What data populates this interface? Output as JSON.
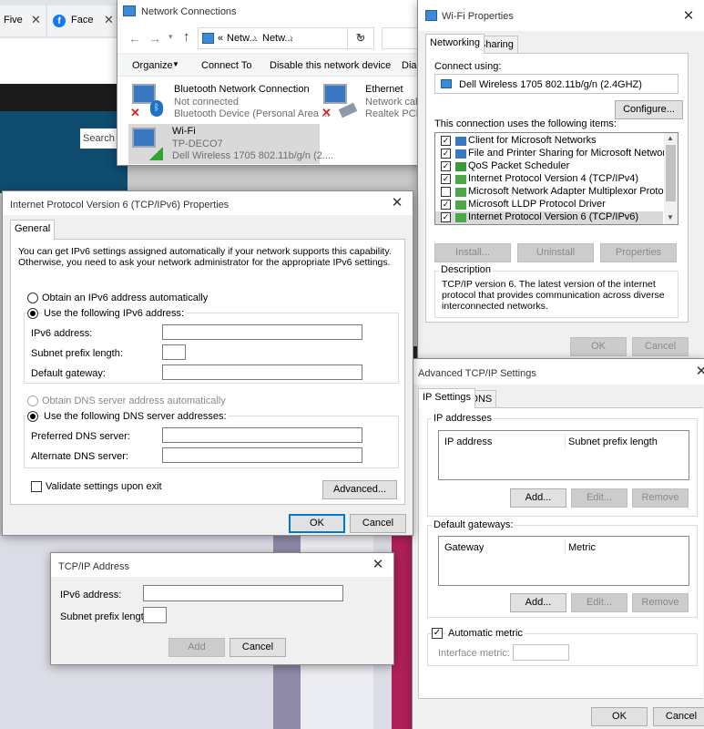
{
  "browser": {
    "tabs": [
      {
        "label": "Five"
      },
      {
        "label": "Face"
      }
    ],
    "search_label": "Search"
  },
  "explorer": {
    "title": "Network Connections",
    "path": [
      "Netw...",
      "Netw..."
    ],
    "toolbar": {
      "organize": "Organize",
      "connect_to": "Connect To",
      "disable": "Disable this network device",
      "diagnose": "Diag"
    },
    "items": [
      {
        "name": "Bluetooth Network Connection",
        "line2": "Not connected",
        "line3": "Bluetooth Device (Personal Area ..."
      },
      {
        "name": "Ethernet",
        "line2": "Network cabl",
        "line3": "Realtek PCIe G"
      },
      {
        "name": "Wi-Fi",
        "line2": "TP-DECO7",
        "line3": "Dell Wireless 1705 802.11b/g/n (2...."
      }
    ]
  },
  "wifi_props": {
    "title": "Wi-Fi Properties",
    "tabs": [
      "Networking",
      "Sharing"
    ],
    "connect_using_label": "Connect using:",
    "adapter": "Dell Wireless 1705 802.11b/g/n (2.4GHZ)",
    "configure": "Configure...",
    "items_label": "This connection uses the following items:",
    "items": [
      {
        "label": "Client for Microsoft Networks",
        "checked": true
      },
      {
        "label": "File and Printer Sharing for Microsoft Networks",
        "checked": true
      },
      {
        "label": "QoS Packet Scheduler",
        "checked": true
      },
      {
        "label": "Internet Protocol Version 4 (TCP/IPv4)",
        "checked": true
      },
      {
        "label": "Microsoft Network Adapter Multiplexor Protocol",
        "checked": false
      },
      {
        "label": "Microsoft LLDP Protocol Driver",
        "checked": true
      },
      {
        "label": "Internet Protocol Version 6 (TCP/IPv6)",
        "checked": true
      }
    ],
    "install": "Install...",
    "uninstall": "Uninstall",
    "properties": "Properties",
    "description_label": "Description",
    "description": "TCP/IP version 6. The latest version of the internet protocol that provides communication across diverse interconnected networks.",
    "ok": "OK",
    "cancel": "Cancel"
  },
  "ipv6_props": {
    "title": "Internet Protocol Version 6 (TCP/IPv6) Properties",
    "tab": "General",
    "intro": "You can get IPv6 settings assigned automatically if your network supports this capability. Otherwise, you need to ask your network administrator for the appropriate IPv6 settings.",
    "auto_ip": "Obtain an IPv6 address automatically",
    "use_ip": "Use the following IPv6 address:",
    "ipv6_address": "IPv6 address:",
    "subnet_prefix": "Subnet prefix length:",
    "default_gateway": "Default gateway:",
    "auto_dns": "Obtain DNS server address automatically",
    "use_dns": "Use the following DNS server addresses:",
    "preferred_dns": "Preferred DNS server:",
    "alternate_dns": "Alternate DNS server:",
    "validate": "Validate settings upon exit",
    "advanced": "Advanced...",
    "ok": "OK",
    "cancel": "Cancel"
  },
  "tcpip_address": {
    "title": "TCP/IP Address",
    "ipv6_address": "IPv6 address:",
    "subnet_prefix": "Subnet prefix length:",
    "add": "Add",
    "cancel": "Cancel"
  },
  "advanced": {
    "title": "Advanced TCP/IP Settings",
    "tabs": [
      "IP Settings",
      "DNS"
    ],
    "ip_addresses": "IP addresses",
    "col_ip": "IP address",
    "col_subnet": "Subnet prefix length",
    "add": "Add...",
    "edit": "Edit...",
    "remove": "Remove",
    "default_gateways": "Default gateways:",
    "col_gateway": "Gateway",
    "col_metric": "Metric",
    "add2": "Add...",
    "edit2": "Edit...",
    "remove2": "Remove",
    "automatic_metric": "Automatic metric",
    "interface_metric": "Interface metric:",
    "ok": "OK",
    "cancel": "Cancel"
  }
}
